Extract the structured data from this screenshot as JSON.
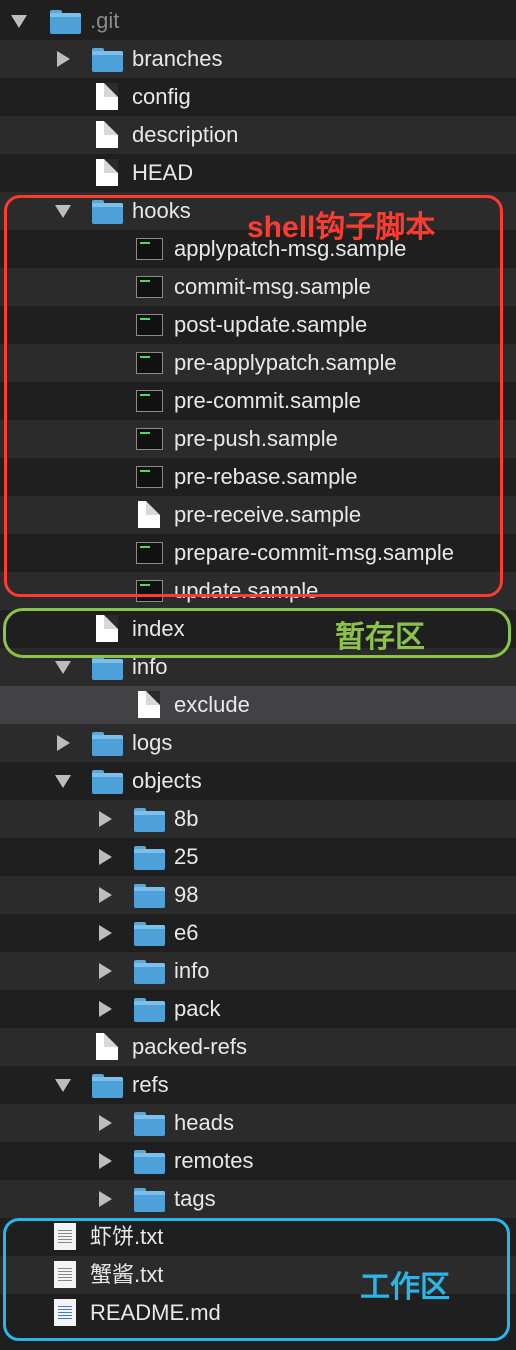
{
  "tree": [
    {
      "label": ".git",
      "type": "folder",
      "expanded": true,
      "depth": 0,
      "dim": true
    },
    {
      "label": "branches",
      "type": "folder",
      "expanded": false,
      "depth": 1
    },
    {
      "label": "config",
      "type": "file",
      "depth": 1
    },
    {
      "label": "description",
      "type": "file",
      "depth": 1
    },
    {
      "label": "HEAD",
      "type": "file",
      "depth": 1
    },
    {
      "label": "hooks",
      "type": "folder",
      "expanded": true,
      "depth": 1
    },
    {
      "label": "applypatch-msg.sample",
      "type": "exec",
      "depth": 2
    },
    {
      "label": "commit-msg.sample",
      "type": "exec",
      "depth": 2
    },
    {
      "label": "post-update.sample",
      "type": "exec",
      "depth": 2
    },
    {
      "label": "pre-applypatch.sample",
      "type": "exec",
      "depth": 2
    },
    {
      "label": "pre-commit.sample",
      "type": "exec",
      "depth": 2
    },
    {
      "label": "pre-push.sample",
      "type": "exec",
      "depth": 2
    },
    {
      "label": "pre-rebase.sample",
      "type": "exec",
      "depth": 2
    },
    {
      "label": "pre-receive.sample",
      "type": "file",
      "depth": 2
    },
    {
      "label": "prepare-commit-msg.sample",
      "type": "exec",
      "depth": 2
    },
    {
      "label": "update.sample",
      "type": "exec",
      "depth": 2
    },
    {
      "label": "index",
      "type": "file",
      "depth": 1
    },
    {
      "label": "info",
      "type": "folder",
      "expanded": true,
      "depth": 1
    },
    {
      "label": "exclude",
      "type": "file",
      "depth": 2,
      "selected": true
    },
    {
      "label": "logs",
      "type": "folder",
      "expanded": false,
      "depth": 1
    },
    {
      "label": "objects",
      "type": "folder",
      "expanded": true,
      "depth": 1
    },
    {
      "label": "8b",
      "type": "folder",
      "expanded": false,
      "depth": 2
    },
    {
      "label": "25",
      "type": "folder",
      "expanded": false,
      "depth": 2
    },
    {
      "label": "98",
      "type": "folder",
      "expanded": false,
      "depth": 2
    },
    {
      "label": "e6",
      "type": "folder",
      "expanded": false,
      "depth": 2
    },
    {
      "label": "info",
      "type": "folder",
      "expanded": false,
      "depth": 2
    },
    {
      "label": "pack",
      "type": "folder",
      "expanded": false,
      "depth": 2
    },
    {
      "label": "packed-refs",
      "type": "file",
      "depth": 1
    },
    {
      "label": "refs",
      "type": "folder",
      "expanded": true,
      "depth": 1
    },
    {
      "label": "heads",
      "type": "folder",
      "expanded": false,
      "depth": 2
    },
    {
      "label": "remotes",
      "type": "folder",
      "expanded": false,
      "depth": 2
    },
    {
      "label": "tags",
      "type": "folder",
      "expanded": false,
      "depth": 2
    },
    {
      "label": "虾饼.txt",
      "type": "txt",
      "depth": 0
    },
    {
      "label": "蟹酱.txt",
      "type": "txt",
      "depth": 0
    },
    {
      "label": "README.md",
      "type": "md",
      "depth": 0
    }
  ],
  "annotations": {
    "hooks": {
      "text": "shell钩子脚本",
      "color": "#ff3b30"
    },
    "staging": {
      "text": "暂存区",
      "color": "#8bc34a"
    },
    "working": {
      "text": "工作区",
      "color": "#29b6e8"
    }
  }
}
